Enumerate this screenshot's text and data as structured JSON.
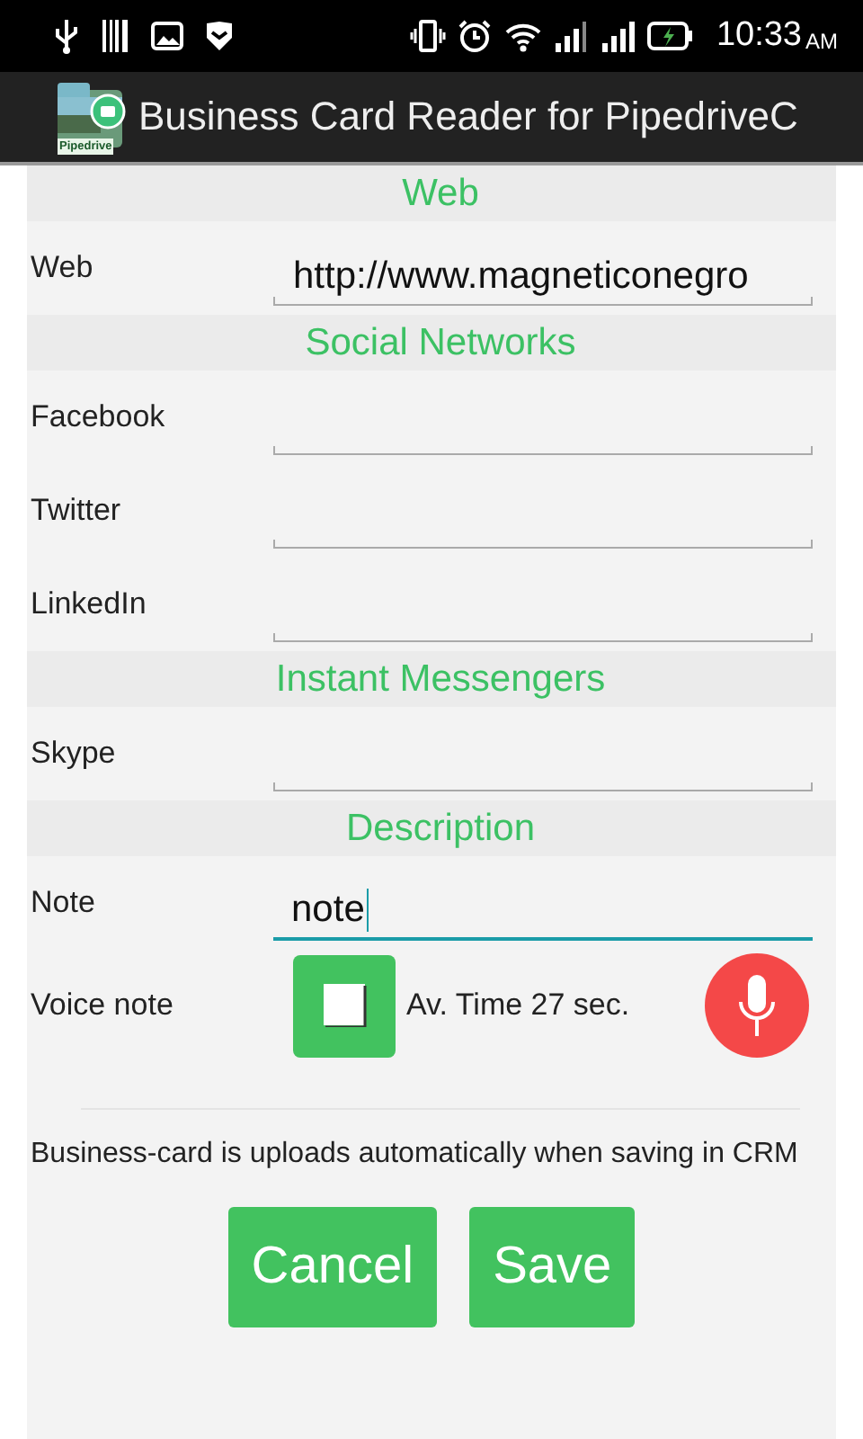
{
  "status_bar": {
    "time": "10:33",
    "ampm": "AM"
  },
  "app_bar": {
    "icon_label": "Pipedrive",
    "title": "Business Card Reader for PipedriveC"
  },
  "sections": [
    {
      "title": "Web",
      "fields": [
        {
          "label": "Web",
          "value": "http://www.magneticonegro",
          "focused": false
        }
      ]
    },
    {
      "title": "Social Networks",
      "fields": [
        {
          "label": "Facebook",
          "focused": false
        },
        {
          "label": "Twitter",
          "focused": false
        },
        {
          "label": "LinkedIn",
          "focused": false
        }
      ]
    },
    {
      "title": "Instant Messengers",
      "fields": [
        {
          "label": "Skype",
          "focused": false
        }
      ]
    },
    {
      "title": "Description",
      "fields": [
        {
          "label": "Note",
          "value": "note",
          "focused": true
        }
      ]
    }
  ],
  "voice_note": {
    "label": "Voice note",
    "time_text": "Av. Time 27 sec."
  },
  "notice": "Business-card is uploads automatically when saving in CRM",
  "buttons": [
    "Cancel",
    "Save"
  ]
}
